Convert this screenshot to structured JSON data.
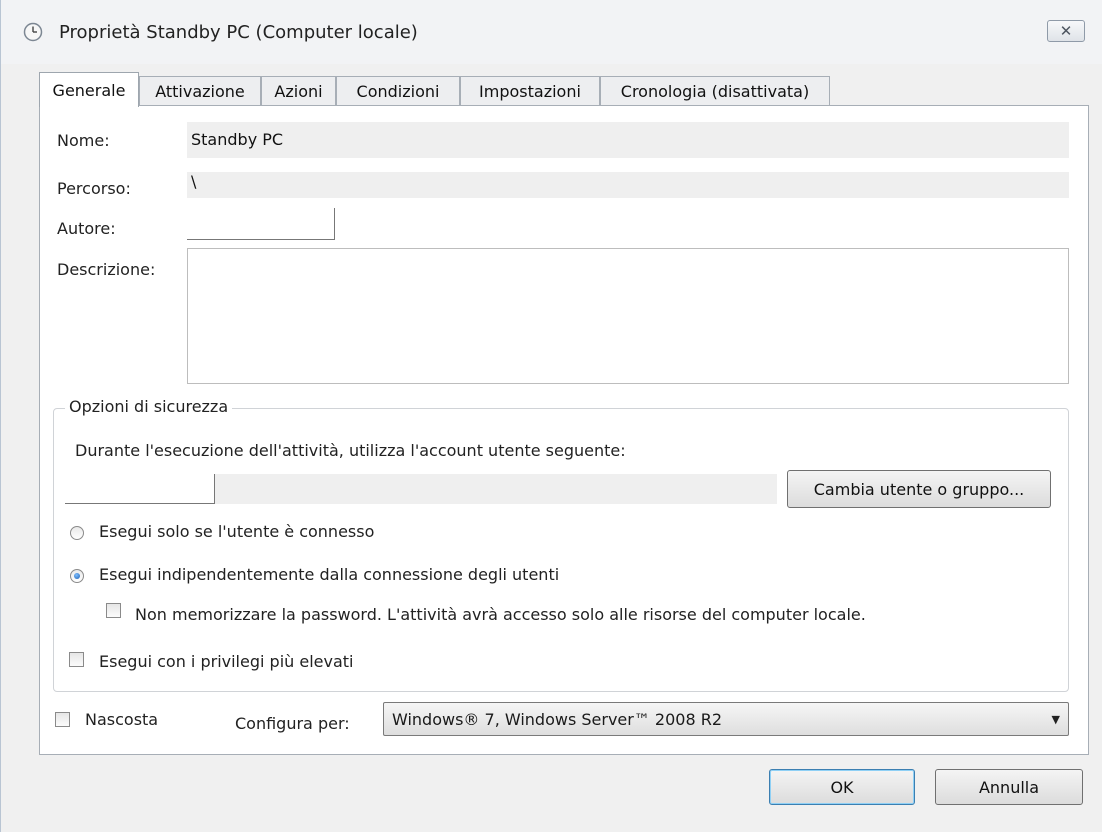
{
  "window": {
    "title": "Proprietà Standby PC (Computer locale)",
    "close_symbol": "✕"
  },
  "tabs": [
    {
      "label": "Generale",
      "active": true
    },
    {
      "label": "Attivazione",
      "active": false
    },
    {
      "label": "Azioni",
      "active": false
    },
    {
      "label": "Condizioni",
      "active": false
    },
    {
      "label": "Impostazioni",
      "active": false
    },
    {
      "label": "Cronologia (disattivata)",
      "active": false
    }
  ],
  "general": {
    "name_label": "Nome:",
    "name_value": "Standby PC",
    "path_label": "Percorso:",
    "path_value": "\\",
    "author_label": "Autore:",
    "author_value": "",
    "description_label": "Descrizione:",
    "description_value": ""
  },
  "security": {
    "group_title": "Opzioni di sicurezza",
    "account_prompt": "Durante l'esecuzione dell'attività, utilizza l'account utente seguente:",
    "user_value": "",
    "change_user_button": "Cambia utente o gruppo...",
    "radio_logged_on": "Esegui solo se l'utente è connesso",
    "radio_logged_on_selected": false,
    "radio_whether": "Esegui indipendentemente dalla connessione degli utenti",
    "radio_whether_selected": true,
    "no_password_checkbox": "Non memorizzare la password. L'attività avrà accesso solo alle risorse del computer locale.",
    "no_password_checked": false,
    "highest_privileges_checkbox": "Esegui con i privilegi più elevati",
    "highest_privileges_checked": false
  },
  "bottom": {
    "hidden_checkbox": "Nascosta",
    "hidden_checked": false,
    "configure_label": "Configura per:",
    "configure_value": "Windows® 7, Windows Server™ 2008 R2"
  },
  "buttons": {
    "ok": "OK",
    "cancel": "Annulla"
  },
  "icons": {
    "title": "clock-icon",
    "close": "close-icon",
    "dropdown": "chevron-down-icon"
  }
}
